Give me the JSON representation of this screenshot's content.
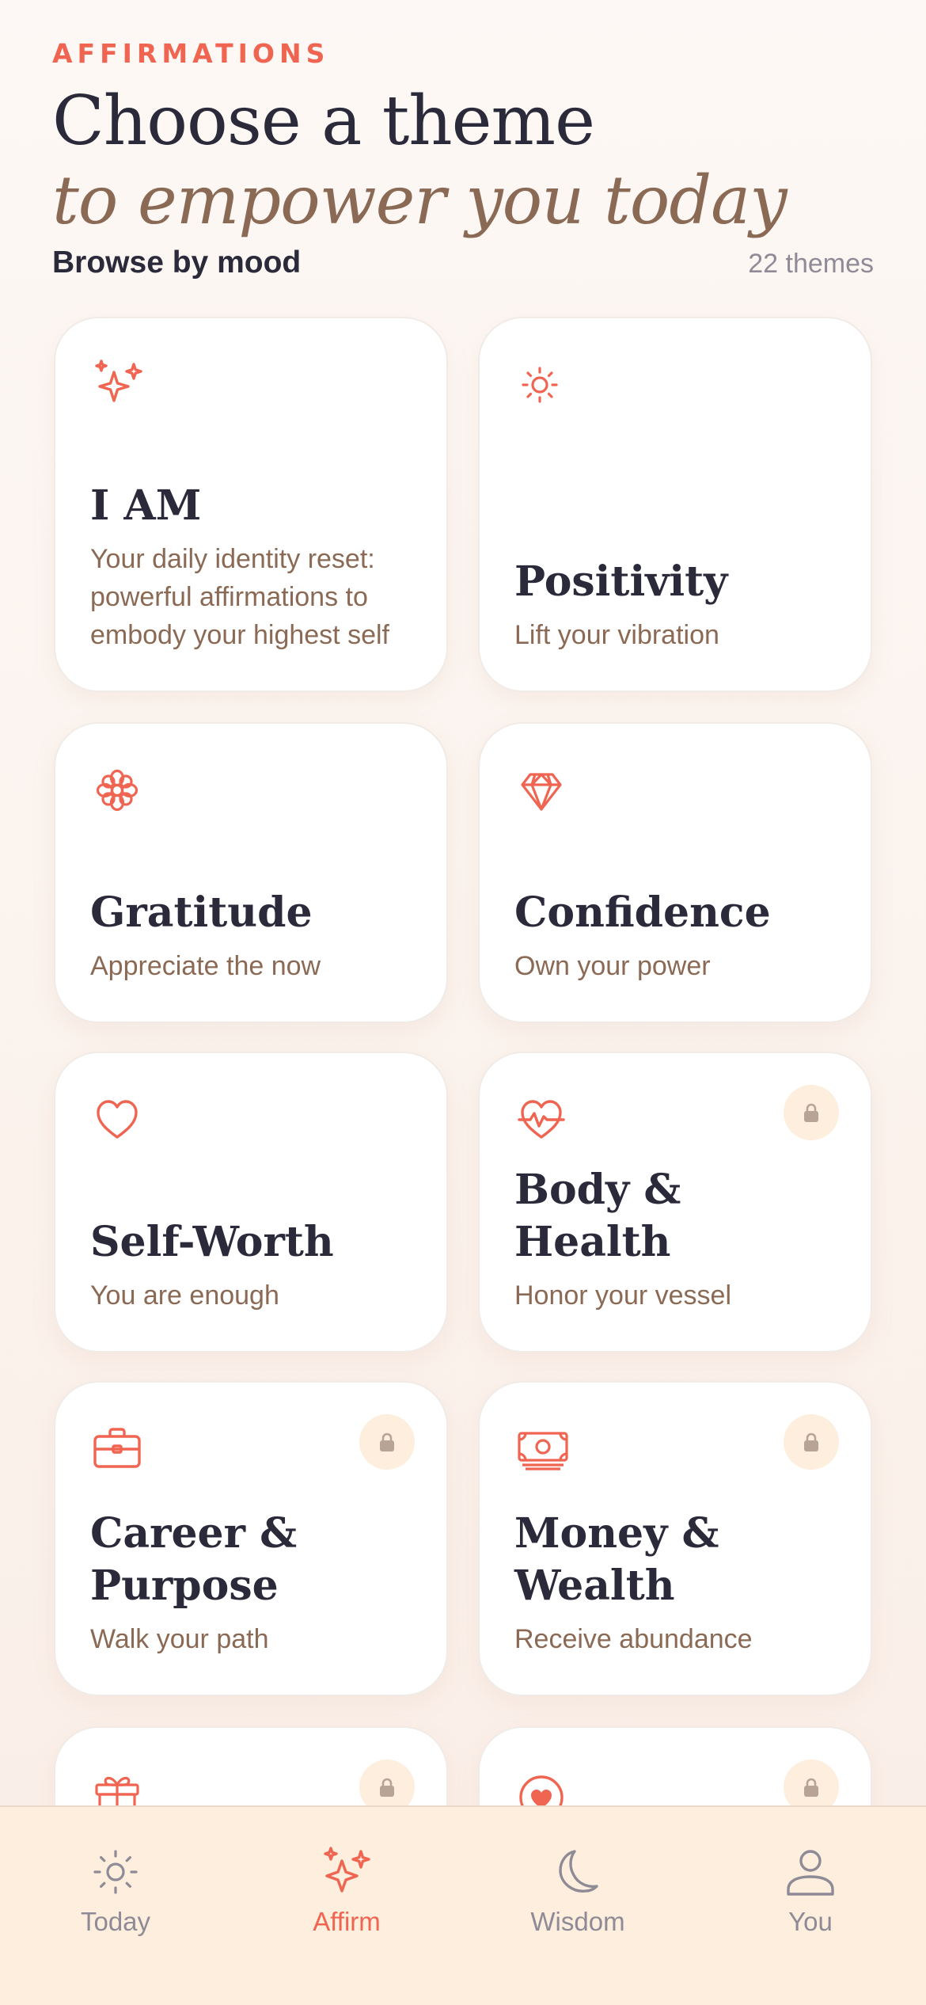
{
  "header": {
    "eyebrow": "AFFIRMATIONS",
    "title": "Choose a theme",
    "subtitle": "to empower you today"
  },
  "browse": {
    "label": "Browse by mood",
    "count": "22 themes"
  },
  "themes": [
    {
      "name": "I AM",
      "desc": "Your daily identity reset: powerful affirmations to embody your highest self",
      "icon": "sparkles-icon",
      "locked": false
    },
    {
      "name": "Positivity",
      "desc": "Lift your vibration",
      "icon": "sun-icon",
      "locked": false
    },
    {
      "name": "Gratitude",
      "desc": "Appreciate the now",
      "icon": "flower-icon",
      "locked": false
    },
    {
      "name": "Confidence",
      "desc": "Own your power",
      "icon": "diamond-icon",
      "locked": false
    },
    {
      "name": "Self-Worth",
      "desc": "You are enough",
      "icon": "heart-icon",
      "locked": false
    },
    {
      "name": "Body & Health",
      "desc": "Honor your vessel",
      "icon": "heartbeat-icon",
      "locked": true
    },
    {
      "name": "Career & Purpose",
      "desc": "Walk your path",
      "icon": "briefcase-icon",
      "locked": true
    },
    {
      "name": "Money & Wealth",
      "desc": "Receive abundance",
      "icon": "banknote-icon",
      "locked": true
    },
    {
      "icon": "gift-icon",
      "locked": true
    },
    {
      "icon": "heart-circle-icon",
      "locked": true
    }
  ],
  "tabs": [
    {
      "label": "Today",
      "icon": "sun-icon",
      "active": false
    },
    {
      "label": "Affirm",
      "icon": "sparkles-icon",
      "active": true
    },
    {
      "label": "Wisdom",
      "icon": "moon-icon",
      "active": false
    },
    {
      "label": "You",
      "icon": "user-icon",
      "active": false
    }
  ],
  "colors": {
    "accent": "#f06552",
    "brown": "#8b6a55",
    "ink": "#2b2a3a",
    "muted": "#8f8b96",
    "tabbar": "#fdeedd",
    "lockBg": "#fdeede"
  }
}
